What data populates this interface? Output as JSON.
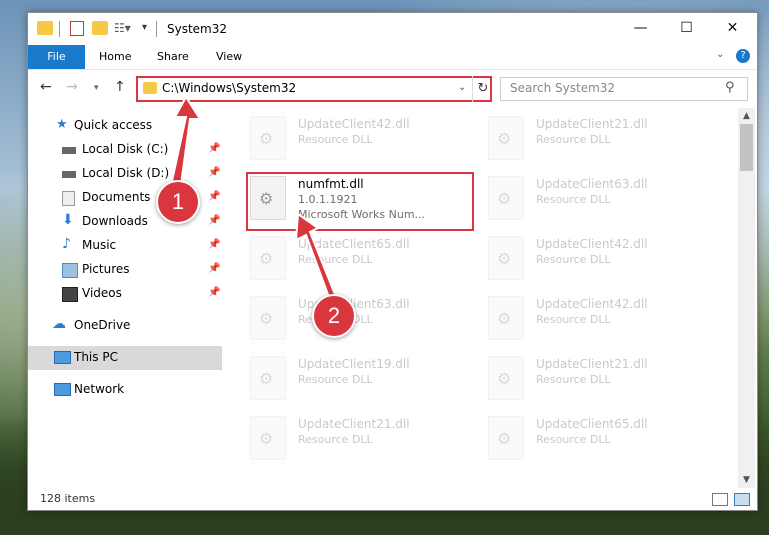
{
  "window": {
    "title": "System32"
  },
  "ribbon": {
    "tabs": [
      "File",
      "Home",
      "Share",
      "View"
    ]
  },
  "address": {
    "path": "C:\\Windows\\System32"
  },
  "search": {
    "placeholder": "Search System32"
  },
  "sidebar": {
    "items": [
      {
        "label": "Quick access",
        "pinned": false,
        "icon": "star-icon"
      },
      {
        "label": "Local Disk (C:)",
        "pinned": true,
        "icon": "drive-icon"
      },
      {
        "label": "Local Disk (D:)",
        "pinned": true,
        "icon": "drive-icon"
      },
      {
        "label": "Documents",
        "pinned": true,
        "icon": "documents-icon"
      },
      {
        "label": "Downloads",
        "pinned": true,
        "icon": "downloads-icon"
      },
      {
        "label": "Music",
        "pinned": true,
        "icon": "music-icon"
      },
      {
        "label": "Pictures",
        "pinned": true,
        "icon": "pictures-icon"
      },
      {
        "label": "Videos",
        "pinned": true,
        "icon": "videos-icon"
      },
      {
        "label": "OneDrive",
        "pinned": false,
        "icon": "cloud-icon"
      },
      {
        "label": "This PC",
        "pinned": false,
        "icon": "pc-icon",
        "selected": true
      },
      {
        "label": "Network",
        "pinned": false,
        "icon": "network-icon"
      }
    ]
  },
  "files": {
    "left": [
      {
        "name": "UpdateClient42.dll",
        "type": "Resource DLL"
      },
      {
        "name": "numfmt.dll",
        "type": "1.0.1.1921",
        "desc": "Microsoft Works Num..."
      },
      {
        "name": "UpdateClient65.dll",
        "type": "Resource DLL"
      },
      {
        "name": "UpdateClient63.dll",
        "type": "Resource DLL"
      },
      {
        "name": "UpdateClient19.dll",
        "type": "Resource DLL"
      },
      {
        "name": "UpdateClient21.dll",
        "type": "Resource DLL"
      }
    ],
    "right": [
      {
        "name": "UpdateClient21.dll",
        "type": "Resource DLL"
      },
      {
        "name": "UpdateClient63.dll",
        "type": "Resource DLL"
      },
      {
        "name": "UpdateClient42.dll",
        "type": "Resource DLL"
      },
      {
        "name": "UpdateClient42.dll",
        "type": "Resource DLL"
      },
      {
        "name": "UpdateClient21.dll",
        "type": "Resource DLL"
      },
      {
        "name": "UpdateClient65.dll",
        "type": "Resource DLL"
      }
    ]
  },
  "status": {
    "items": "128 items"
  },
  "callouts": {
    "one": "1",
    "two": "2"
  },
  "colors": {
    "accent": "#1979ca",
    "highlight": "#d9363e"
  }
}
